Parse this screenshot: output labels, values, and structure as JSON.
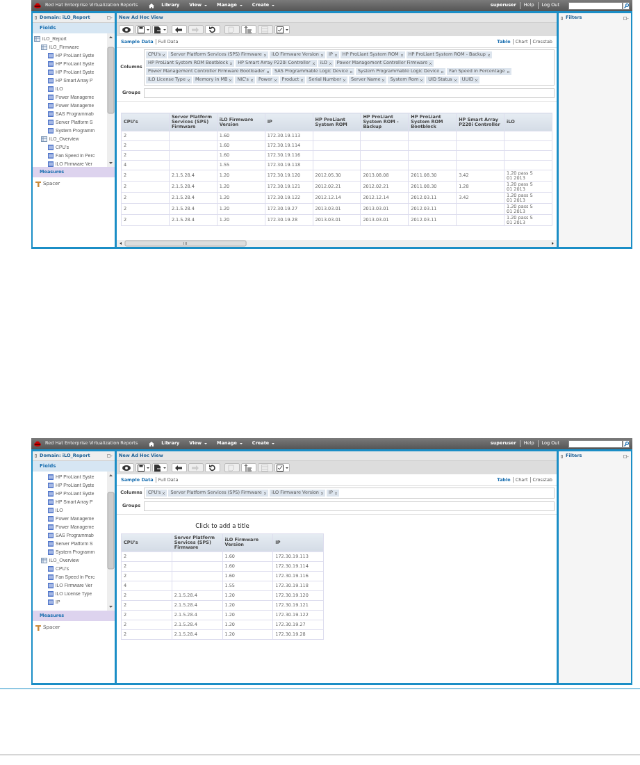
{
  "screenshots": [
    {
      "header": {
        "product": "Red Hat Enterprise Virtualization Reports",
        "nav": [
          {
            "label": "Library",
            "has_menu": false
          },
          {
            "label": "View",
            "has_menu": true
          },
          {
            "label": "Manage",
            "has_menu": true
          },
          {
            "label": "Create",
            "has_menu": true
          }
        ],
        "links": [
          "superuser",
          "Help",
          "Log Out"
        ]
      },
      "left": {
        "title": "Domain: iLO_Report",
        "fields_heading": "Fields",
        "tree": [
          {
            "label": "iLO_Report",
            "children": [
              {
                "label": "iLO_Firmware",
                "children": [
                  {
                    "label": "HP ProLiant Syste"
                  },
                  {
                    "label": "HP ProLiant Syste"
                  },
                  {
                    "label": "HP ProLiant Syste"
                  },
                  {
                    "label": "HP Smart Array P"
                  },
                  {
                    "label": "iLO"
                  },
                  {
                    "label": "Power Manageme"
                  },
                  {
                    "label": "Power Manageme"
                  },
                  {
                    "label": "SAS Programmab"
                  },
                  {
                    "label": "Server Platform S"
                  },
                  {
                    "label": "System Programm"
                  }
                ]
              },
              {
                "label": "iLO_Overview",
                "children": [
                  {
                    "label": "CPU's"
                  },
                  {
                    "label": "Fan Speed in Perc"
                  },
                  {
                    "label": "iLO Firmware Ver"
                  }
                ]
              }
            ]
          }
        ],
        "measures_heading": "Measures",
        "measures": [
          "Spacer"
        ]
      },
      "center": {
        "title": "New Ad Hoc View",
        "toolbar": [
          {
            "kind": "eye",
            "has_menu": false,
            "disabled": false
          },
          {
            "kind": "save",
            "has_menu": true,
            "disabled": false
          },
          {
            "kind": "export",
            "has_menu": true,
            "disabled": false
          },
          {
            "kind": "undo",
            "has_menu": false,
            "disabled": false
          },
          {
            "kind": "redo",
            "has_menu": false,
            "disabled": true
          },
          {
            "kind": "reset",
            "has_menu": false,
            "disabled": false
          },
          {
            "kind": "pivot",
            "has_menu": false,
            "disabled": true
          },
          {
            "kind": "sort",
            "has_menu": false,
            "disabled": false
          },
          {
            "kind": "layout",
            "has_menu": false,
            "disabled": true
          },
          {
            "kind": "options",
            "has_menu": true,
            "disabled": false
          }
        ],
        "data_modes": [
          {
            "label": "Sample Data",
            "selected": true
          },
          {
            "label": "Full Data",
            "selected": false
          }
        ],
        "view_modes": [
          {
            "label": "Table",
            "selected": true
          },
          {
            "label": "Chart",
            "selected": false
          },
          {
            "label": "Crosstab",
            "selected": false
          }
        ],
        "columns_label": "Columns",
        "columns": [
          "CPU's",
          "Server Platform Services (SPS) Firmware",
          "iLO Firmware Version",
          "IP",
          "HP ProLiant System ROM",
          "HP ProLiant System ROM - Backup",
          "HP ProLiant System ROM Bootblock",
          "HP Smart Array P220i Controller",
          "iLO",
          "Power Management Controller Firmware",
          "Power Management Controller Firmware Bootloader",
          "SAS Programmable Logic Device",
          "System Programmable Logic Device",
          "Fan Speed in Percentage",
          "iLO License Type",
          "Memory in MB",
          "NIC's",
          "Power",
          "Product",
          "Serial Number",
          "Server Name",
          "System Rom",
          "UID Status",
          "UUID"
        ],
        "groups_label": "Groups",
        "table": {
          "h_scroll": true,
          "columns": [
            "CPU's",
            "Server Platform Services (SPS) Firmware",
            "iLO Firmware Version",
            "IP",
            "HP ProLiant System ROM",
            "HP ProLiant System ROM - Backup",
            "HP ProLiant System ROM Bootblock",
            "HP Smart Array P220i Controller",
            "iLO"
          ],
          "rows": [
            [
              "2",
              null,
              "1.60",
              "172.30.19.113",
              null,
              null,
              null,
              null,
              null
            ],
            [
              "2",
              null,
              "1.60",
              "172.30.19.114",
              null,
              null,
              null,
              null,
              null
            ],
            [
              "2",
              null,
              "1.60",
              "172.30.19.116",
              null,
              null,
              null,
              null,
              null
            ],
            [
              "4",
              null,
              "1.55",
              "172.30.19.118",
              null,
              null,
              null,
              null,
              null
            ],
            [
              "2",
              "2.1.5.28.4",
              "1.20",
              "172.30.19.120",
              "2012.05.30",
              "2013.08.08",
              "2011.08.30",
              "3.42",
              "1.20 pass S\n01 2013"
            ],
            [
              "2",
              "2.1.5.28.4",
              "1.20",
              "172.30.19.121",
              "2012.02.21",
              "2012.02.21",
              "2011.08.30",
              "1.28",
              "1.20 pass S\n01 2013"
            ],
            [
              "2",
              "2.1.5.28.4",
              "1.20",
              "172.30.19.122",
              "2012.12.14",
              "2012.12.14",
              "2012.03.11",
              "3.42",
              "1.20 pass S\n01 2013"
            ],
            [
              "2",
              "2.1.5.28.4",
              "1.20",
              "172.30.19.27",
              "2013.03.01",
              "2013.03.01",
              "2012.03.11",
              null,
              "1.20 pass S\n01 2013"
            ],
            [
              "2",
              "2.1.5.28.4",
              "1.20",
              "172.30.19.28",
              "2013.03.01",
              "2013.03.01",
              "2012.03.11",
              null,
              "1.20 pass S\n01 2013"
            ]
          ]
        }
      },
      "right": {
        "title": "Filters"
      }
    },
    {
      "header": {
        "product": "Red Hat Enterprise Virtualization Reports",
        "nav": [
          {
            "label": "Library",
            "has_menu": false
          },
          {
            "label": "View",
            "has_menu": true
          },
          {
            "label": "Manage",
            "has_menu": true
          },
          {
            "label": "Create",
            "has_menu": true
          }
        ],
        "links": [
          "superuser",
          "Help",
          "Log Out"
        ]
      },
      "left": {
        "title": "Domain: iLO_Report",
        "fields_heading": "Fields",
        "tree": [
          {
            "children": [
              {
                "children": [
                  {
                    "label": "HP ProLiant Syste"
                  },
                  {
                    "label": "HP ProLiant Syste"
                  },
                  {
                    "label": "HP ProLiant Syste"
                  },
                  {
                    "label": "HP Smart Array P"
                  },
                  {
                    "label": "iLO"
                  },
                  {
                    "label": "Power Manageme"
                  },
                  {
                    "label": "Power Manageme"
                  },
                  {
                    "label": "SAS Programmab"
                  },
                  {
                    "label": "Server Platform S"
                  },
                  {
                    "label": "System Programm"
                  }
                ]
              },
              {
                "label": "iLO_Overview",
                "children": [
                  {
                    "label": "CPU's"
                  },
                  {
                    "label": "Fan Speed in Perc"
                  },
                  {
                    "label": "iLO Firmware Ver"
                  },
                  {
                    "label": "iLO License Type"
                  },
                  {
                    "label": "IP"
                  }
                ]
              }
            ]
          }
        ],
        "measures_heading": "Measures",
        "measures": [
          "Spacer"
        ]
      },
      "center": {
        "title": "New Ad Hoc View",
        "toolbar": [
          {
            "kind": "eye",
            "has_menu": false,
            "disabled": false
          },
          {
            "kind": "save",
            "has_menu": true,
            "disabled": false
          },
          {
            "kind": "export",
            "has_menu": true,
            "disabled": false
          },
          {
            "kind": "undo",
            "has_menu": false,
            "disabled": false
          },
          {
            "kind": "redo",
            "has_menu": false,
            "disabled": true
          },
          {
            "kind": "reset",
            "has_menu": false,
            "disabled": false
          },
          {
            "kind": "pivot",
            "has_menu": false,
            "disabled": true
          },
          {
            "kind": "sort",
            "has_menu": false,
            "disabled": false
          },
          {
            "kind": "layout",
            "has_menu": false,
            "disabled": true
          },
          {
            "kind": "options",
            "has_menu": true,
            "disabled": false
          }
        ],
        "data_modes": [
          {
            "label": "Sample Data",
            "selected": true
          },
          {
            "label": "Full Data",
            "selected": false
          }
        ],
        "view_modes": [
          {
            "label": "Table",
            "selected": true
          },
          {
            "label": "Chart",
            "selected": false
          },
          {
            "label": "Crosstab",
            "selected": false
          }
        ],
        "columns_label": "Columns",
        "columns": [
          "CPU's",
          "Server Platform Services (SPS) Firmware",
          "iLO Firmware Version",
          "IP"
        ],
        "groups_label": "Groups",
        "table_title": "Click to add a title",
        "table": {
          "h_scroll": false,
          "columns": [
            "CPU's",
            "Server Platform Services (SPS) Firmware",
            "iLO Firmware Version",
            "IP"
          ],
          "rows": [
            [
              "2",
              null,
              "1.60",
              "172.30.19.113"
            ],
            [
              "2",
              null,
              "1.60",
              "172.30.19.114"
            ],
            [
              "2",
              null,
              "1.60",
              "172.30.19.116"
            ],
            [
              "4",
              null,
              "1.55",
              "172.30.19.118"
            ],
            [
              "2",
              "2.1.5.28.4",
              "1.20",
              "172.30.19.120"
            ],
            [
              "2",
              "2.1.5.28.4",
              "1.20",
              "172.30.19.121"
            ],
            [
              "2",
              "2.1.5.28.4",
              "1.20",
              "172.30.19.122"
            ],
            [
              "2",
              "2.1.5.28.4",
              "1.20",
              "172.30.19.27"
            ],
            [
              "2",
              "2.1.5.28.4",
              "1.20",
              "172.30.19.28"
            ]
          ]
        }
      },
      "right": {
        "title": "Filters"
      }
    }
  ]
}
